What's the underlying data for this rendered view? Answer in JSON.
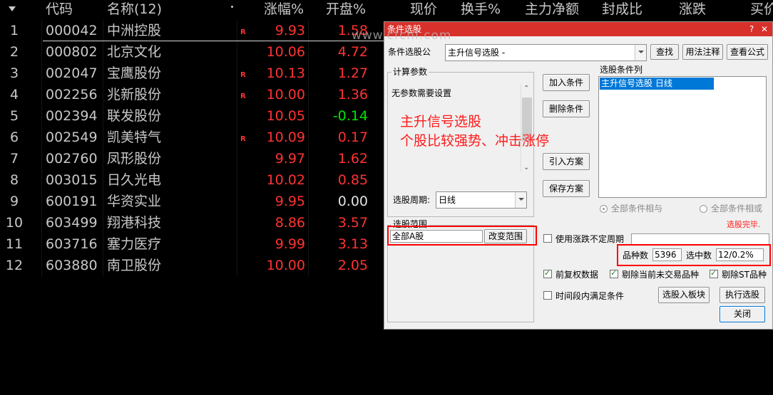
{
  "table": {
    "headers": [
      "代码",
      "名称(12)",
      "涨幅%",
      "开盘%",
      "现价",
      "换手%",
      "主力净额",
      "封成比",
      "涨跌",
      "买价"
    ],
    "rows": [
      {
        "no": "1",
        "code": "000042",
        "name": "中洲控股",
        "flag": "R",
        "chg": "9.93",
        "open": "1.58",
        "open_color": "red"
      },
      {
        "no": "2",
        "code": "000802",
        "name": "北京文化",
        "flag": "",
        "chg": "10.06",
        "open": "4.72",
        "open_color": "red"
      },
      {
        "no": "3",
        "code": "002047",
        "name": "宝鹰股份",
        "flag": "R",
        "chg": "10.13",
        "open": "1.27",
        "open_color": "red"
      },
      {
        "no": "4",
        "code": "002256",
        "name": "兆新股份",
        "flag": "R",
        "chg": "10.00",
        "open": "1.36",
        "open_color": "red"
      },
      {
        "no": "5",
        "code": "002394",
        "name": "联发股份",
        "flag": "",
        "chg": "10.05",
        "open": "-0.14",
        "open_color": "green"
      },
      {
        "no": "6",
        "code": "002549",
        "name": "凯美特气",
        "flag": "R",
        "chg": "10.09",
        "open": "0.17",
        "open_color": "red"
      },
      {
        "no": "7",
        "code": "002760",
        "name": "凤形股份",
        "flag": "",
        "chg": "9.97",
        "open": "1.62",
        "open_color": "red"
      },
      {
        "no": "8",
        "code": "003015",
        "name": "日久光电",
        "flag": "",
        "chg": "10.02",
        "open": "0.85",
        "open_color": "red"
      },
      {
        "no": "9",
        "code": "600191",
        "name": "华资实业",
        "flag": "",
        "chg": "9.95",
        "open": "0.00",
        "open_color": "white"
      },
      {
        "no": "10",
        "code": "603499",
        "name": "翔港科技",
        "flag": "",
        "chg": "8.86",
        "open": "3.57",
        "open_color": "red"
      },
      {
        "no": "11",
        "code": "603716",
        "name": "塞力医疗",
        "flag": "",
        "chg": "9.99",
        "open": "3.13",
        "open_color": "red"
      },
      {
        "no": "12",
        "code": "603880",
        "name": "南卫股份",
        "flag": "",
        "chg": "10.00",
        "open": "2.05",
        "open_color": "red"
      }
    ]
  },
  "dialog": {
    "title": "条件选股",
    "watermark": "www.cfchi.com",
    "formula_label": "条件选股公",
    "formula_value": "主升信号选股  -",
    "find_btn": "查找",
    "usage_btn": "用法注释",
    "view_btn": "查看公式",
    "params_group": "计算参数",
    "params_text": "无参数需要设置",
    "annotation_line1": "主升信号选股",
    "annotation_line2": "个股比较强势、冲击涨停",
    "period_label": "选股周期:",
    "period_value": "日线",
    "add_btn": "加入条件",
    "del_btn": "删除条件",
    "import_btn": "引入方案",
    "save_btn": "保存方案",
    "cond_list_label": "选股条件列",
    "cond_list_item": "主升信号选股  日线",
    "radio_and": "全部条件相与",
    "radio_or": "全部条件相或",
    "status": "选股完毕.",
    "range_group": "选股范围",
    "range_value": "全部A股",
    "change_range_btn": "改变范围",
    "nofix_period": "使用涨跌不定周期",
    "count_label": "品种数",
    "count_value": "5396",
    "selected_label": "选中数",
    "selected_value": "12/0.2%",
    "fq_label": "前复权数据",
    "exclude_notrade": "剔除当前未交易品种",
    "exclude_st": "剔除ST品种",
    "time_cond": "时间段内满足条件",
    "to_block_btn": "选股入板块",
    "run_btn": "执行选股",
    "close_btn": "关闭"
  },
  "colors": {
    "rise": "#ff3232",
    "fall": "#00e600",
    "title_bar": "#d8302a",
    "list_selection": "#0078d7"
  }
}
